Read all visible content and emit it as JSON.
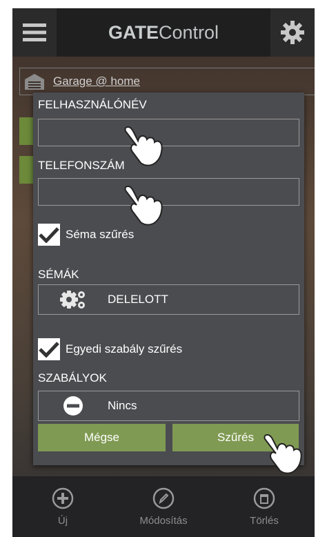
{
  "header": {
    "title_bold": "GATE",
    "title_rest": "Control"
  },
  "background": {
    "device_label": "Garage @ home"
  },
  "dialog": {
    "username_label": "FELHASZNÁLÓNÉV",
    "username_value": "",
    "phone_label": "TELEFONSZÁM",
    "phone_value": "",
    "schema_filter_label": "Séma szűrés",
    "schema_filter_checked": true,
    "schemas_label": "SÉMÁK",
    "schema_value": "DELELOTT",
    "rule_filter_label": "Egyedi szabály szűrés",
    "rule_filter_checked": true,
    "rules_label": "SZABÁLYOK",
    "rule_value": "Nincs",
    "cancel_label": "Mégse",
    "filter_label": "Szűrés"
  },
  "footer": {
    "new_label": "Új",
    "edit_label": "Módosítás",
    "delete_label": "Törlés"
  },
  "colors": {
    "accent_green": "#7f9a52",
    "dialog_bg": "#4b4c50",
    "header_bg": "#1f1f20"
  }
}
